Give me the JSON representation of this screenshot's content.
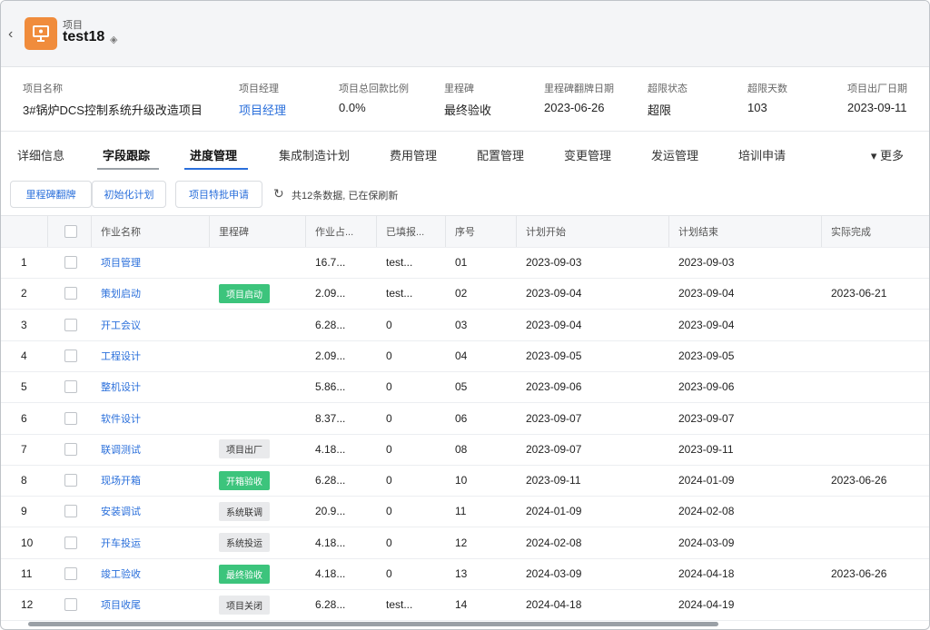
{
  "header": {
    "subtitle": "项目",
    "title": "test18"
  },
  "info": [
    {
      "label": "项目名称",
      "value": "3#锅炉DCS控制系统升级改造项目",
      "link": false
    },
    {
      "label": "项目经理",
      "value": "项目经理",
      "link": true
    },
    {
      "label": "项目总回款比例",
      "value": "0.0%",
      "link": false
    },
    {
      "label": "里程碑",
      "value": "最终验收",
      "link": false
    },
    {
      "label": "里程碑翻牌日期",
      "value": "2023-06-26",
      "link": false
    },
    {
      "label": "超限状态",
      "value": "超限",
      "link": false
    },
    {
      "label": "超限天数",
      "value": "103",
      "link": false
    },
    {
      "label": "项目出厂日期",
      "value": "2023-09-11",
      "link": false
    }
  ],
  "tabs": [
    "详细信息",
    "字段跟踪",
    "进度管理",
    "集成制造计划",
    "费用管理",
    "配置管理",
    "变更管理",
    "发运管理",
    "培训申请"
  ],
  "more_label": "更多",
  "toolbar": {
    "buttons": [
      "里程碑翻牌",
      "初始化计划",
      "项目特批申请"
    ],
    "count_text": "共12条数据, 已在保刷新"
  },
  "table": {
    "headers": [
      "",
      "",
      "作业名称",
      "里程碑",
      "作业占...",
      "已填报...",
      "序号",
      "计划开始",
      "计划结束",
      "实际完成"
    ],
    "rows": [
      {
        "no": "1",
        "name": "项目管理",
        "milestone": "",
        "green": false,
        "pct": "16.7...",
        "filled": "test...",
        "seq": "01",
        "start": "2023-09-03",
        "end": "2023-09-03",
        "actual": ""
      },
      {
        "no": "2",
        "name": "策划启动",
        "milestone": "项目启动",
        "green": true,
        "pct": "2.09...",
        "filled": "test...",
        "seq": "02",
        "start": "2023-09-04",
        "end": "2023-09-04",
        "actual": "2023-06-21"
      },
      {
        "no": "3",
        "name": "开工会议",
        "milestone": "",
        "green": false,
        "pct": "6.28...",
        "filled": "0",
        "seq": "03",
        "start": "2023-09-04",
        "end": "2023-09-04",
        "actual": ""
      },
      {
        "no": "4",
        "name": "工程设计",
        "milestone": "",
        "green": false,
        "pct": "2.09...",
        "filled": "0",
        "seq": "04",
        "start": "2023-09-05",
        "end": "2023-09-05",
        "actual": ""
      },
      {
        "no": "5",
        "name": "整机设计",
        "milestone": "",
        "green": false,
        "pct": "5.86...",
        "filled": "0",
        "seq": "05",
        "start": "2023-09-06",
        "end": "2023-09-06",
        "actual": ""
      },
      {
        "no": "6",
        "name": "软件设计",
        "milestone": "",
        "green": false,
        "pct": "8.37...",
        "filled": "0",
        "seq": "06",
        "start": "2023-09-07",
        "end": "2023-09-07",
        "actual": ""
      },
      {
        "no": "7",
        "name": "联调测试",
        "milestone": "项目出厂",
        "green": false,
        "pct": "4.18...",
        "filled": "0",
        "seq": "08",
        "start": "2023-09-07",
        "end": "2023-09-11",
        "actual": ""
      },
      {
        "no": "8",
        "name": "现场开箱",
        "milestone": "开箱验收",
        "green": true,
        "pct": "6.28...",
        "filled": "0",
        "seq": "10",
        "start": "2023-09-11",
        "end": "2024-01-09",
        "actual": "2023-06-26"
      },
      {
        "no": "9",
        "name": "安装调试",
        "milestone": "系统联调",
        "green": false,
        "pct": "20.9...",
        "filled": "0",
        "seq": "11",
        "start": "2024-01-09",
        "end": "2024-02-08",
        "actual": ""
      },
      {
        "no": "10",
        "name": "开车投运",
        "milestone": "系统投运",
        "green": false,
        "pct": "4.18...",
        "filled": "0",
        "seq": "12",
        "start": "2024-02-08",
        "end": "2024-03-09",
        "actual": ""
      },
      {
        "no": "11",
        "name": "竣工验收",
        "milestone": "最终验收",
        "green": true,
        "pct": "4.18...",
        "filled": "0",
        "seq": "13",
        "start": "2024-03-09",
        "end": "2024-04-18",
        "actual": "2023-06-26"
      },
      {
        "no": "12",
        "name": "项目收尾",
        "milestone": "项目关闭",
        "green": false,
        "pct": "6.28...",
        "filled": "test...",
        "seq": "14",
        "start": "2024-04-18",
        "end": "2024-04-19",
        "actual": ""
      }
    ]
  },
  "colors": {
    "link": "#2a6fdb",
    "badge_green": "#3cc47c",
    "app_icon": "#f08c3c"
  }
}
